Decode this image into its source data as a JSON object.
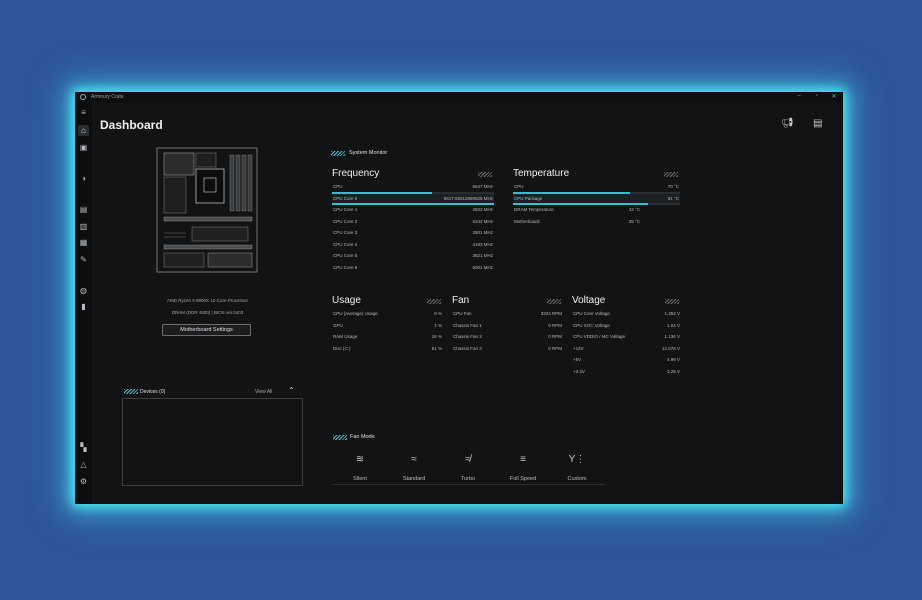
{
  "window": {
    "title": "Armoury Crate",
    "controls": {
      "minimize": "–",
      "maximize": "▫",
      "close": "✕"
    }
  },
  "sidebar": {
    "icons": [
      "menu-icon",
      "home-icon",
      "device-icon",
      "aura-icon",
      "hardware-icon",
      "library-icon",
      "scenario-icon",
      "game-icon",
      "deals-icon",
      "news-icon",
      "user-center-icon",
      "notification-icon",
      "settings-icon"
    ]
  },
  "header": {
    "title": "Dashboard"
  },
  "motherboard": {
    "cpu": "AMD Ryzen 9 9900X 12-Core Processor",
    "dram": "DRAM (DDR 4800) | BIOS ver.0403",
    "settings_button": "Motherboard Settings"
  },
  "devices": {
    "title": "Devices (0)",
    "view_all": "View All"
  },
  "system_monitor": {
    "title": "System Monitor",
    "frequency": {
      "title": "Frequency",
      "rows": [
        {
          "label": "CPU",
          "value": "5637 MHz",
          "level": 0.62
        },
        {
          "label": "CPU Core 0",
          "value": "5617.68212890625 MHz",
          "level": 1.0
        },
        {
          "label": "CPU Core 1",
          "value": "2803 MHz"
        },
        {
          "label": "CPU Core 2",
          "value": "5342 MHz"
        },
        {
          "label": "CPU Core 3",
          "value": "2801 MHz"
        },
        {
          "label": "CPU Core 4",
          "value": "4193 MHz"
        },
        {
          "label": "CPU Core 5",
          "value": "3621 MHz"
        },
        {
          "label": "CPU Core 6",
          "value": "5001 MHz"
        }
      ]
    },
    "temperature": {
      "title": "Temperature",
      "rows": [
        {
          "label": "CPU",
          "value": "70 °C",
          "level": 0.7
        },
        {
          "label": "CPU Package",
          "value": "81 °C",
          "level": 0.81
        },
        {
          "label": "DRAM Temperature",
          "value": "42 °C"
        },
        {
          "label": "Motherboard",
          "value": "35 °C"
        }
      ]
    },
    "usage": {
      "title": "Usage",
      "rows": [
        {
          "label": "CPU (Average) Usage",
          "value": "9 %"
        },
        {
          "label": "GPU",
          "value": "1 %"
        },
        {
          "label": "RAM Usage",
          "value": "16 %"
        },
        {
          "label": "Disc (C:)",
          "value": "51 %"
        }
      ]
    },
    "fan": {
      "title": "Fan",
      "rows": [
        {
          "label": "CPU Fan",
          "value": "3324 RPM"
        },
        {
          "label": "Chassis Fan 1",
          "value": "0 RPM"
        },
        {
          "label": "Chassis Fan 2",
          "value": "0 RPM"
        },
        {
          "label": "Chassis Fan 3",
          "value": "0 RPM"
        }
      ]
    },
    "voltage": {
      "title": "Voltage",
      "rows": [
        {
          "label": "CPU Core Voltage",
          "value": "1.352 V"
        },
        {
          "label": "CPU SOC Voltage",
          "value": "1.04 V"
        },
        {
          "label": "CPU VDDIO / MC Voltage",
          "value": "1.136 V"
        },
        {
          "label": "+12V",
          "value": "12.076 V"
        },
        {
          "label": "+5V",
          "value": "4.98 V"
        },
        {
          "label": "+3.3V",
          "value": "3.28 V"
        }
      ]
    }
  },
  "fan_mode": {
    "title": "Fan Mode",
    "options": [
      {
        "label": "Silent",
        "icon": "silent-fan-icon"
      },
      {
        "label": "Standard",
        "icon": "standard-fan-icon"
      },
      {
        "label": "Turbo",
        "icon": "turbo-fan-icon"
      },
      {
        "label": "Full Speed",
        "icon": "full-speed-fan-icon"
      },
      {
        "label": "Custom",
        "icon": "custom-fan-icon"
      }
    ]
  },
  "colors": {
    "accent": "#2dc2cf",
    "background": "#121314",
    "glow": "#49e6f5",
    "desktop": "#2e5699"
  }
}
